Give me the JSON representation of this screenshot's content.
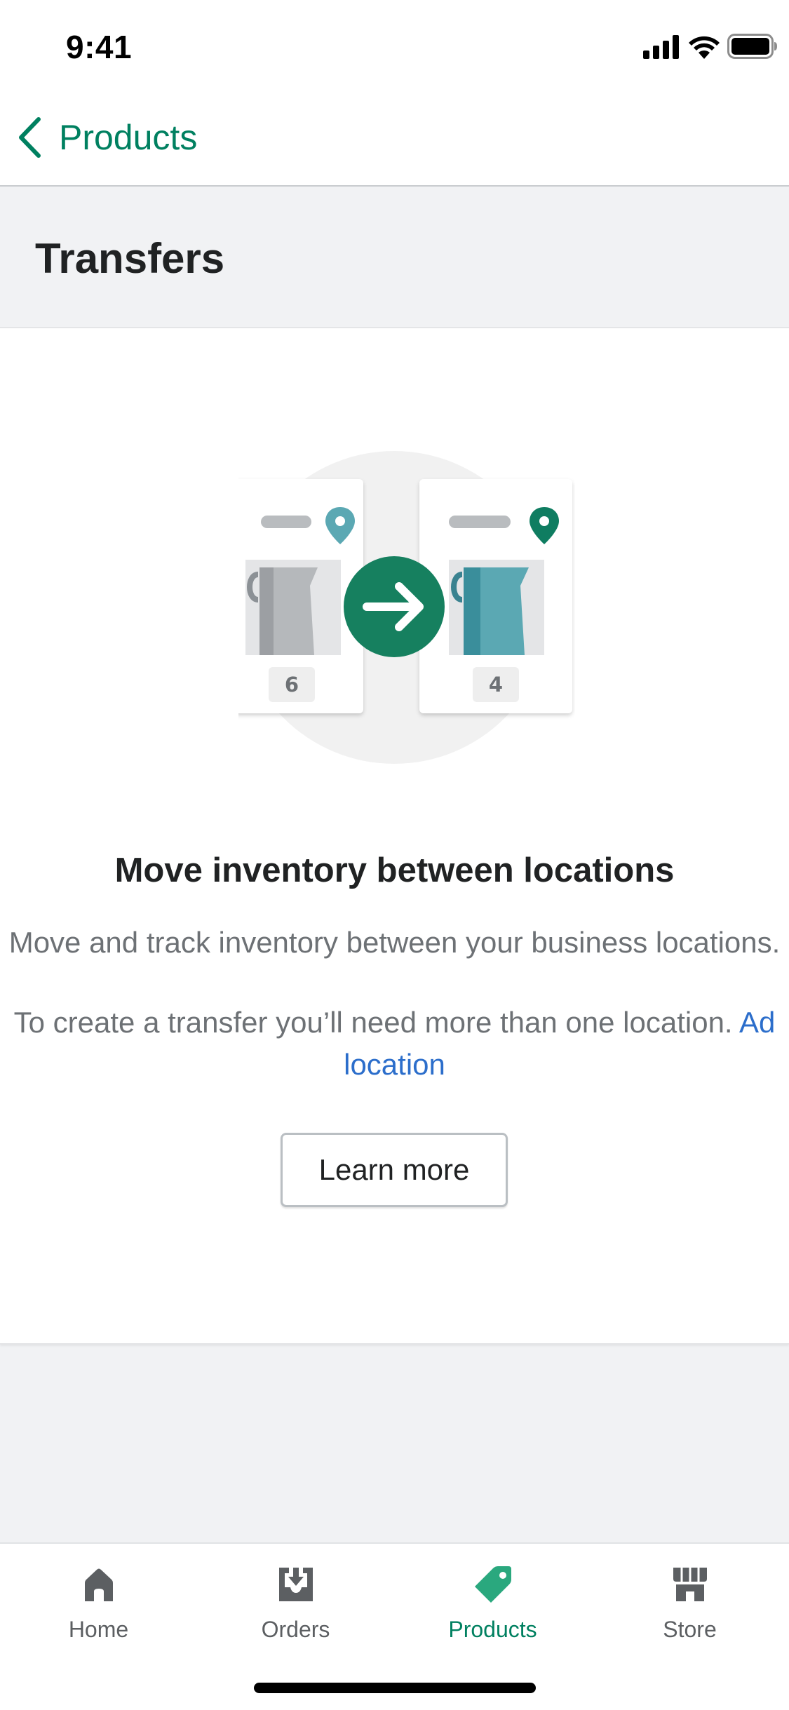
{
  "status_bar": {
    "time": "9:41",
    "icons": [
      "cellular-signal-icon",
      "wifi-icon",
      "battery-icon"
    ]
  },
  "nav": {
    "back_label": "Products",
    "back_icon": "chevron-left-icon"
  },
  "page": {
    "title": "Transfers"
  },
  "empty_state": {
    "illustration": "inventory-transfer-illustration",
    "source_quantity": "6",
    "destination_quantity": "4",
    "heading": "Move inventory between locations",
    "description": "Move and track inventory between your business locations.",
    "note": "To create a transfer you’ll need more than one location.",
    "link_part1": "Ad",
    "link_part2": "location",
    "button_label": "Learn more"
  },
  "tab_bar": {
    "tabs": [
      {
        "label": "Home",
        "icon": "home-icon",
        "active": false
      },
      {
        "label": "Orders",
        "icon": "orders-inbox-icon",
        "active": false
      },
      {
        "label": "Products",
        "icon": "tag-icon",
        "active": true
      },
      {
        "label": "Store",
        "icon": "store-icon",
        "active": false
      }
    ]
  },
  "colors": {
    "accent": "#008060",
    "link": "#2c6ecb",
    "page_background": "#f1f2f4",
    "text_subdued": "#6d7175",
    "illustration_teal": "#5ba8b3"
  }
}
